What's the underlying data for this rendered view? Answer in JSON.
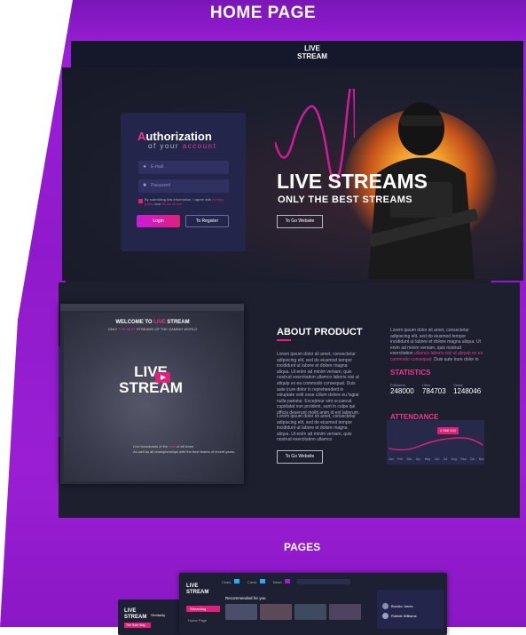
{
  "hero_title": "HOME PAGE",
  "logo": {
    "line1": "LIVE",
    "line2": "STREAM"
  },
  "auth": {
    "title_initial": "A",
    "title_rest": "uthorization",
    "sub_prefix": "of your ",
    "sub_accent": "account",
    "email_placeholder": "E-mail",
    "password_placeholder": "Password",
    "agree_text": "By submitting this information, I agree with",
    "agree_link1": "privacy policy",
    "agree_and": "and",
    "agree_link2": "Terms of use",
    "login_label": "Login",
    "register_label": "To Register"
  },
  "hero": {
    "headline": "LIVE STREAMS",
    "subheadline": "ONLY THE BEST STREAMS",
    "cta": "To Go Website"
  },
  "mockup": {
    "welcome_prefix": "WELCOME TO ",
    "welcome_accent": "LIVE",
    "welcome_suffix": " STREAM",
    "sub_prefix": "ONLY ",
    "sub_accent": "THE BEST",
    "sub_suffix": " STREAMS OF THE GAMING WORLD",
    "logo_line1": "LIVE",
    "logo_line2": "STREAM",
    "caption_l1a": "Live broadcasts of the ",
    "caption_l1b": "best",
    "caption_l1c": " of all times",
    "caption_l2": "As well as all championships with the best teams of recent years."
  },
  "about": {
    "title": "ABOUT PRODUCT",
    "p1": "Lorem ipsum dolor sit amet, consectetur adipiscing elit, sed do eiusmod tempor incididunt ut labore et dolore magna aliqua. Ut enim ad minim veniam, quis nostrud exercitation ullamco laboris nisi ut aliquip ex ea commodo consequat. Duis aute irure dolor in reprehenderit in voluptate velit esse cillum dolore eu fugiat nulla pariatur. Excepteur sint occaecat cupidatat non proident, sunt in culpa qui officia deserunt mollit anim id est laborum.",
    "p2": "Lorem ipsum dolor sit amet, consectetur adipiscing elit, sed do eiusmod tempor incididunt ut labore et dolore magna aliqua. Ut enim ad minim veniam, quis nostrud exercitation ullamco",
    "cta": "To Go Website"
  },
  "side_text": {
    "a": "Lorem ipsum dolor sit amet, consectetur adipiscing elit, sed do eiusmod tempor incididunt ut labore et dolore magna aliqua. Ut enim ad minim veniam, quis nostrud exercitation ",
    "b": "ullamco laboris nisi ut aliquip ex ea commodo consequat.",
    "c": " Duis aute irure dolor in"
  },
  "stats": {
    "title": "STATISTICS",
    "items": [
      {
        "label": "Followers",
        "value": "248000"
      },
      {
        "label": "Likes",
        "value": "784703"
      },
      {
        "label": "Views",
        "value": "1248046"
      }
    ]
  },
  "attendance": {
    "title": "ATTENDANCE",
    "badge": "2 988 400",
    "months": [
      "Jan",
      "Feb",
      "Mar",
      "Apr",
      "May",
      "Jun",
      "Jul",
      "Aug",
      "Sep",
      "Oct",
      "Nov"
    ]
  },
  "pages": {
    "title": "PAGES",
    "tabs": [
      "Chats",
      "Cards",
      "Music"
    ],
    "recommended": "Recommended for you",
    "streaming": "Streaming",
    "home_page": "Home Page",
    "similarity": "Similarity",
    "list_item": "The Safe Way",
    "user1": "Brooke Jones",
    "user2": "Robbie Williams"
  },
  "colors": {
    "accent": "#e0207a",
    "purple": "#9b1fd6",
    "dark": "#1b1d2b"
  }
}
